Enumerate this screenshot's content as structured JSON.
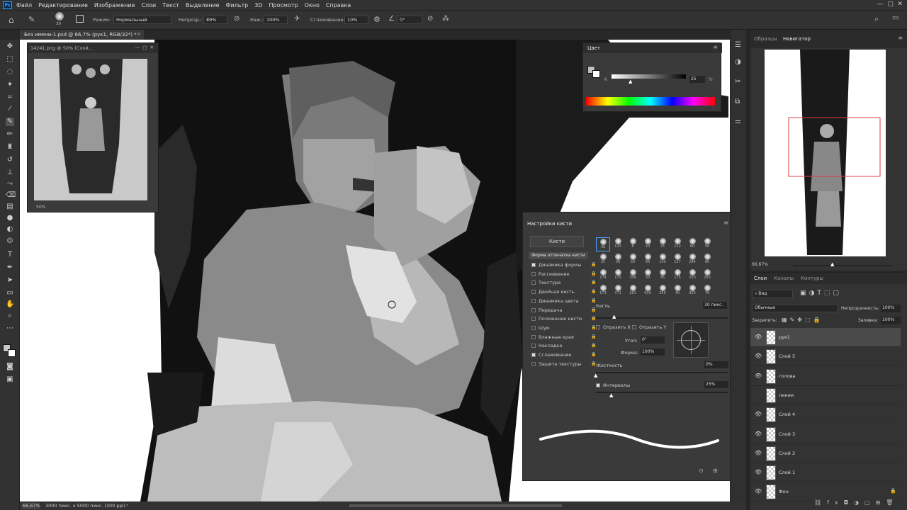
{
  "menu": {
    "logo": "Ps",
    "items": [
      "Файл",
      "Редактирование",
      "Изображение",
      "Слои",
      "Текст",
      "Выделение",
      "Фильтр",
      "3D",
      "Просмотр",
      "Окно",
      "Справка"
    ]
  },
  "options": {
    "brush_size": "30",
    "mode_label": "Режим:",
    "mode_value": "Нормальный",
    "opacity_label": "Непрозр.:",
    "opacity_value": "89%",
    "flow_label": "Наж.:",
    "flow_value": "100%",
    "smoothing_label": "Сглаживание:",
    "smoothing_value": "10%",
    "angle_value": "0°"
  },
  "document": {
    "tab_title": "Без имени-1.psd @ 66,7% (рук1, RGB/32*) *",
    "zoom": "66,67%",
    "dimensions": "3000 пикс. x 5000 пикс. (300 ppi)"
  },
  "reference_window": {
    "title": "14241.png @ 50% (Слой...",
    "zoom": "50%"
  },
  "color_panel": {
    "title": "Цвет",
    "channel": "K",
    "value": "25",
    "unit": "%"
  },
  "brush_settings": {
    "title": "Настройки кисти",
    "brushes_button": "Кисти",
    "tip_shape": "Форма отпечатка кисти",
    "options": [
      {
        "label": "Динамика формы",
        "checked": true
      },
      {
        "label": "Рассеивание",
        "checked": false
      },
      {
        "label": "Текстура",
        "checked": false
      },
      {
        "label": "Двойная кисть",
        "checked": false
      },
      {
        "label": "Динамика цвета",
        "checked": false
      },
      {
        "label": "Передача",
        "checked": false
      },
      {
        "label": "Положение кисти",
        "checked": false
      },
      {
        "label": "Шум",
        "checked": false
      },
      {
        "label": "Влажные края",
        "checked": false
      },
      {
        "label": "Накладка",
        "checked": false
      },
      {
        "label": "Сглаживание",
        "checked": true
      },
      {
        "label": "Защита текстуры",
        "checked": false
      }
    ],
    "brush_sizes_row1": [
      "30",
      "123",
      "8",
      "10",
      "25",
      "112",
      "60",
      "50"
    ],
    "brush_sizes_row2": [
      "25",
      "30",
      "50",
      "60",
      "100",
      "127",
      "284",
      "80"
    ],
    "brush_sizes_row3": [
      "174",
      "175",
      "306",
      "50",
      "45",
      "175",
      "250",
      "250"
    ],
    "brush_sizes_row4": [
      "173",
      "771",
      "261",
      "500",
      "250",
      "40",
      "335",
      "70"
    ],
    "size_label": "Кегль",
    "size_value": "30 пикс.",
    "flip_x": "Отразить X",
    "flip_y": "Отразить Y",
    "angle_label": "Угол:",
    "angle_value": "0°",
    "roundness_label": "Форма:",
    "roundness_value": "100%",
    "hardness_label": "Жесткость",
    "hardness_value": "0%",
    "spacing_label": "Интервалы",
    "spacing_value": "25%",
    "spacing_checked": true
  },
  "navigator": {
    "tabs": [
      "Образцы",
      "Навигатор"
    ],
    "active_tab": "Навигатор",
    "zoom": "66,67%"
  },
  "layers_panel": {
    "tabs": [
      "Слои",
      "Каналы",
      "Контуры"
    ],
    "active_tab": "Слои",
    "filter": "Вид",
    "blend_mode": "Обычные",
    "opacity_label": "Непрозрачность:",
    "opacity_value": "100%",
    "lock_label": "Закрепить:",
    "fill_label": "Заливка:",
    "fill_value": "100%",
    "layers": [
      {
        "name": "рук1",
        "visible": true,
        "active": true
      },
      {
        "name": "Слой 5",
        "visible": true,
        "active": false
      },
      {
        "name": "голова",
        "visible": true,
        "active": false
      },
      {
        "name": "линии",
        "visible": false,
        "active": false
      },
      {
        "name": "Слой 4",
        "visible": true,
        "active": false
      },
      {
        "name": "Слой 3",
        "visible": true,
        "active": false
      },
      {
        "name": "Слой 2",
        "visible": true,
        "active": false
      },
      {
        "name": "Слой 1",
        "visible": true,
        "active": false
      },
      {
        "name": "Фон",
        "visible": true,
        "active": false
      }
    ]
  }
}
